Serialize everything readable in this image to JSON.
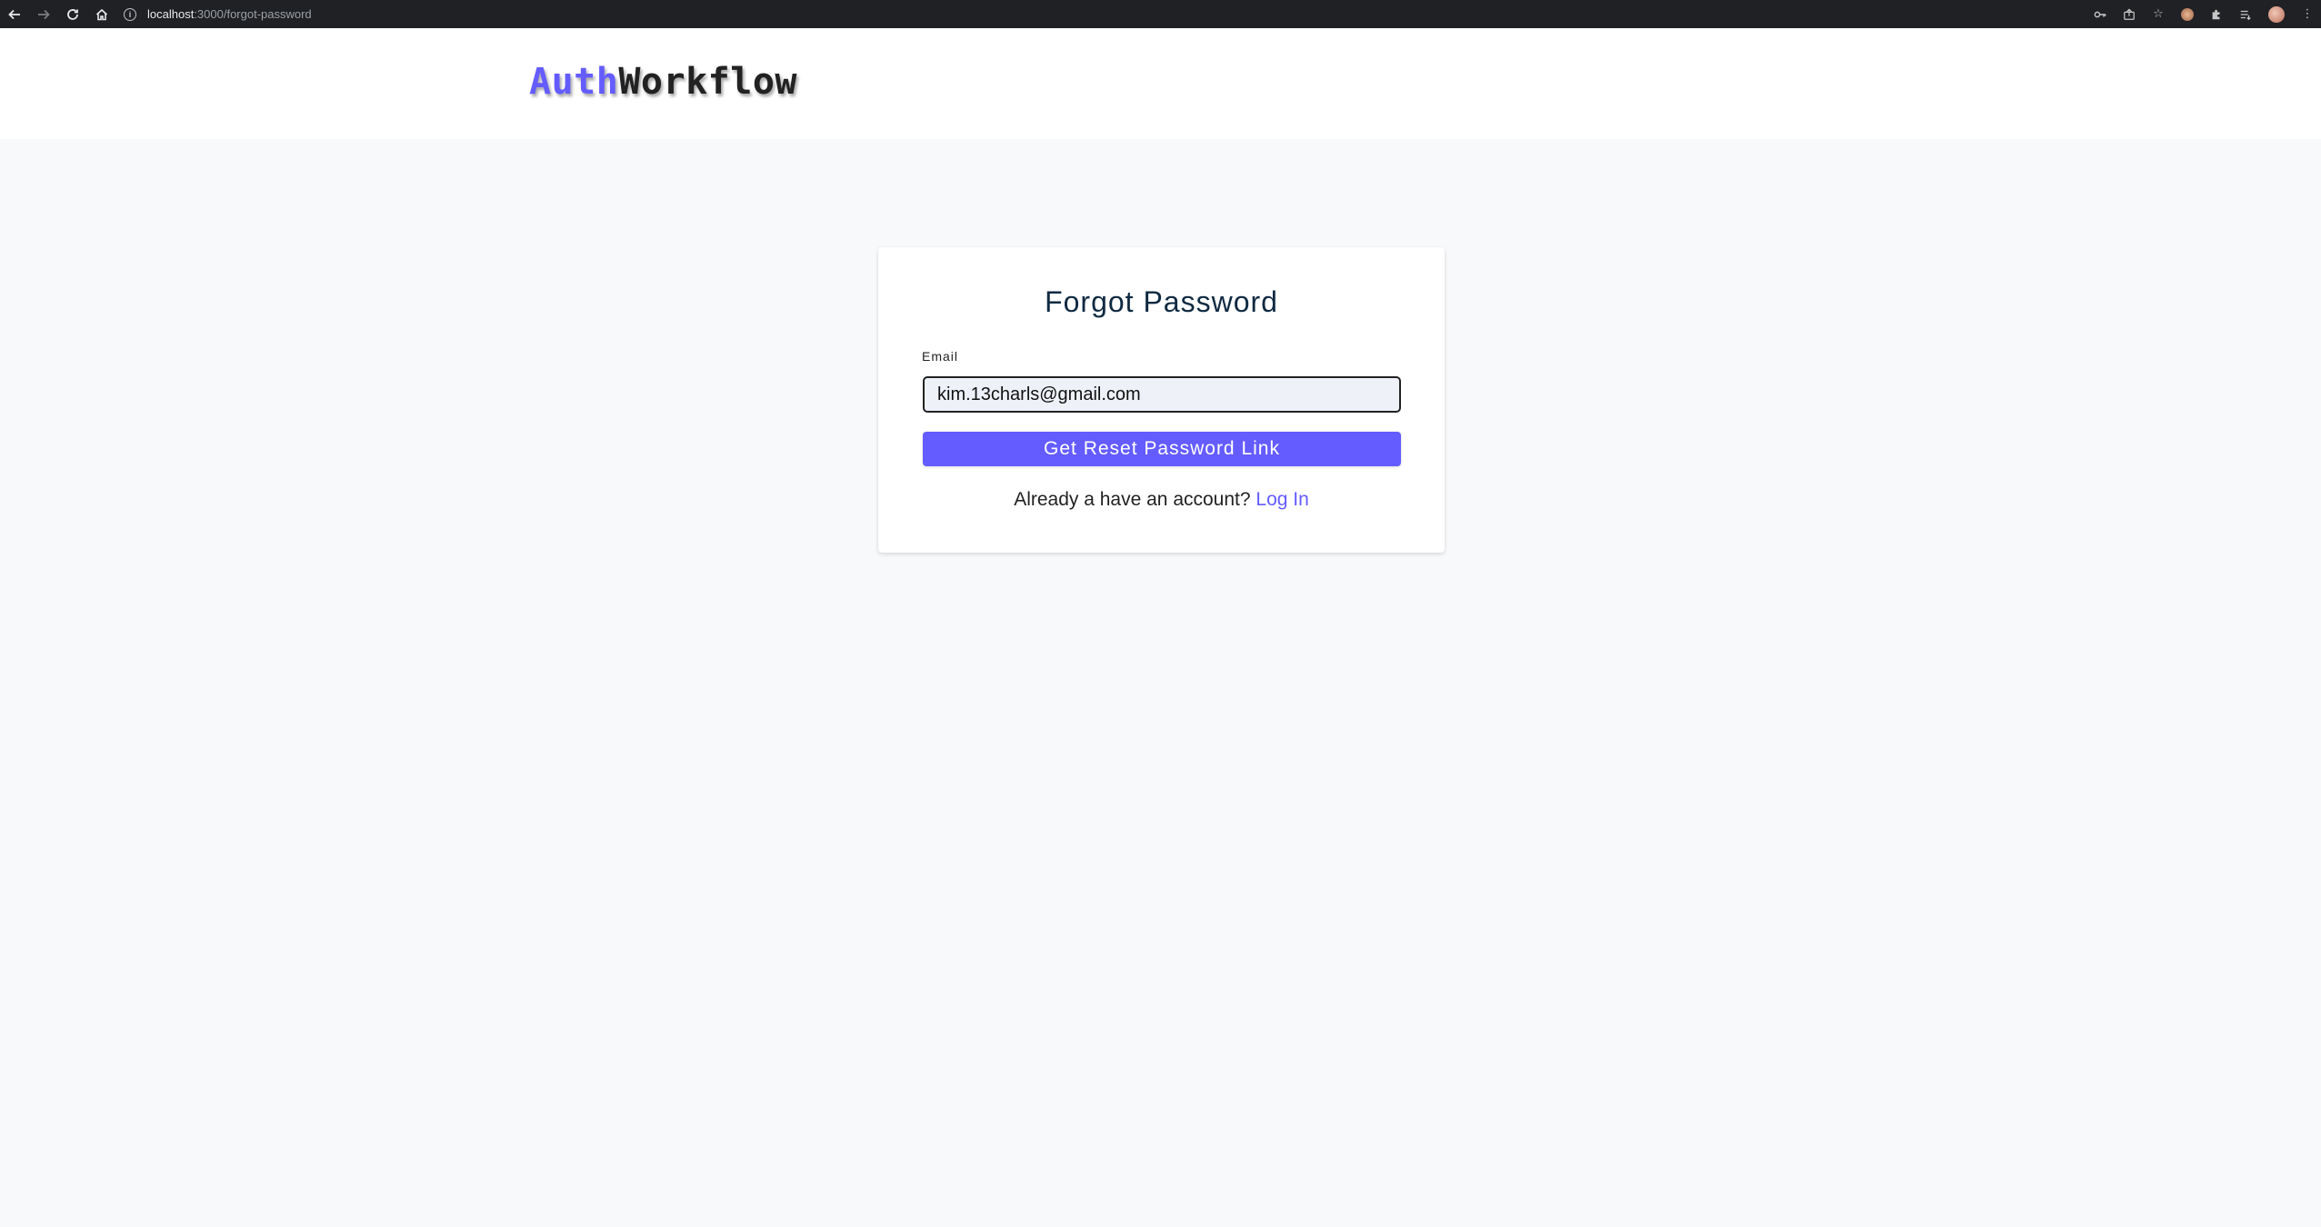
{
  "browser": {
    "url_host": "localhost",
    "url_path": ":3000/forgot-password"
  },
  "header": {
    "logo_part1": "Auth",
    "logo_part2": "Workflow"
  },
  "form": {
    "title": "Forgot Password",
    "email_label": "Email",
    "email_value": "kim.13charls@gmail.com",
    "submit_label": "Get Reset Password Link",
    "footer_text": "Already a have an account?",
    "login_link": "Log In"
  },
  "colors": {
    "primary": "#645cff",
    "page_bg": "#f8f9fb",
    "title": "#102a42"
  }
}
